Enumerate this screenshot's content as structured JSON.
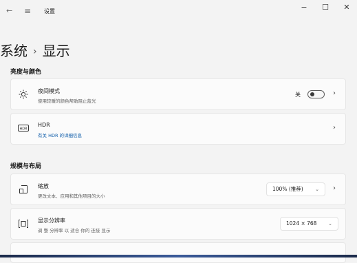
{
  "titlebar": {
    "back_icon": "back-arrow-icon",
    "menu_icon": "hamburger-icon",
    "title": "设置",
    "minimize": "−",
    "maximize": "☐",
    "close": "✕"
  },
  "breadcrumb": {
    "parent": "系统",
    "separator": "›",
    "current": "显示"
  },
  "sections": {
    "brightness": {
      "heading": "亮度与颜色"
    },
    "layout": {
      "heading": "规模与布局"
    }
  },
  "night_light": {
    "icon": "sun-icon",
    "title": "夜间模式",
    "subtitle": "使用较暖的颜色帮助阻止蓝光",
    "toggle_label": "关",
    "toggle_state": "off"
  },
  "hdr": {
    "icon": "hdr-icon",
    "icon_text": "HDR",
    "title": "HDR",
    "link": "有关 HDR 的详细信息"
  },
  "scale": {
    "icon": "scale-icon",
    "title": "缩放",
    "subtitle": "更改文本、应用和其他项目的大小",
    "value": "100% (推荐)"
  },
  "resolution": {
    "icon": "resolution-icon",
    "title": "显示分辨率",
    "subtitle": "调 整 分辨率 以 适合 你的 连接 显示",
    "value": "1024 × 768"
  },
  "chevron": "›",
  "dropdown_chevron": "⌄"
}
